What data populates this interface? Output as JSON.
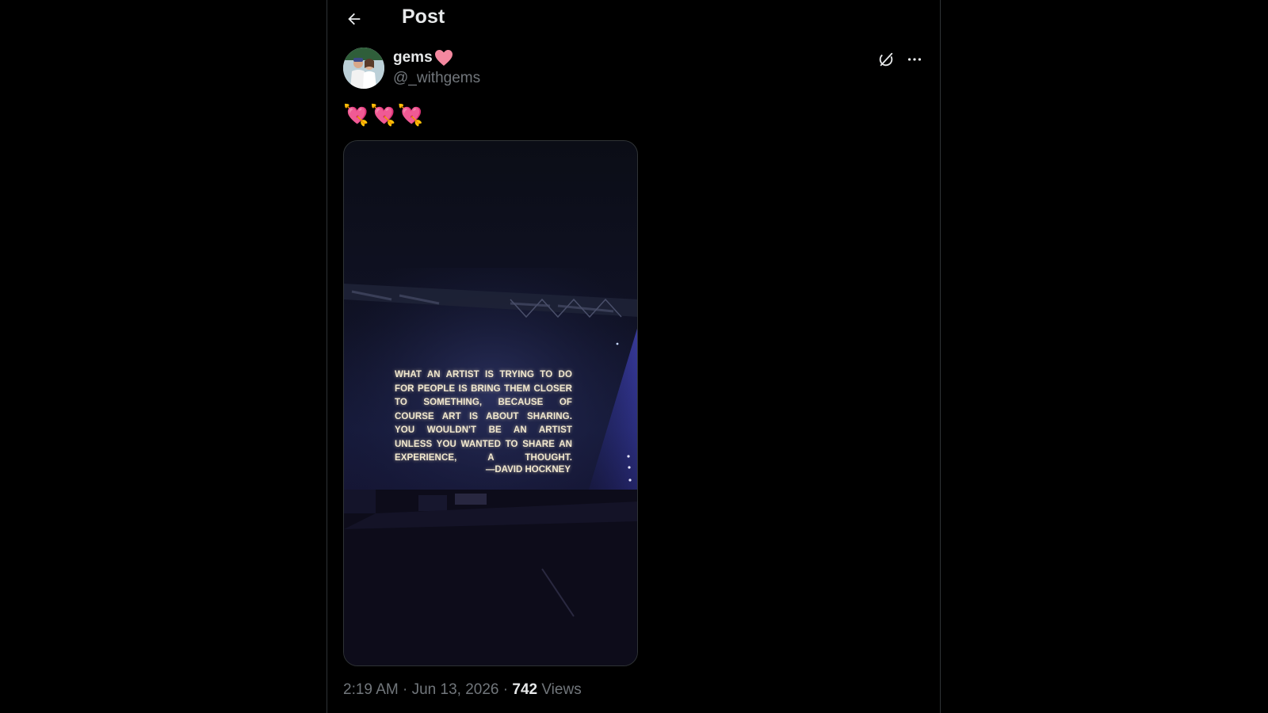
{
  "header": {
    "title": "Post"
  },
  "post": {
    "display_name": "gems",
    "name_emoji": "❤",
    "handle": "@_withgems",
    "text_emojis": [
      "💘",
      "💘",
      "💘"
    ],
    "media": {
      "quote_lines": [
        "WHAT AN ARTIST IS TRYING TO DO",
        "FOR PEOPLE IS BRING THEM CLOSER",
        "TO SOMETHING, BECAUSE OF",
        "COURSE ART IS ABOUT SHARING.",
        "YOU WOULDN'T BE AN ARTIST",
        "UNLESS YOU WANTED TO SHARE AN",
        "EXPERIENCE, A THOUGHT."
      ],
      "attribution": "—DAVID HOCKNEY"
    },
    "time": "2:19 AM",
    "separator": " · ",
    "date": "Jun 13, 2026",
    "views_count": "742",
    "views_label": " Views"
  },
  "icons": {
    "back": "arrow-left-icon",
    "grok": "grok-icon",
    "more": "more-icon"
  },
  "colors": {
    "background": "#000000",
    "text_primary": "#e7e9ea",
    "text_secondary": "#71767b",
    "border": "#2f3336",
    "heart": "#f4889f"
  }
}
